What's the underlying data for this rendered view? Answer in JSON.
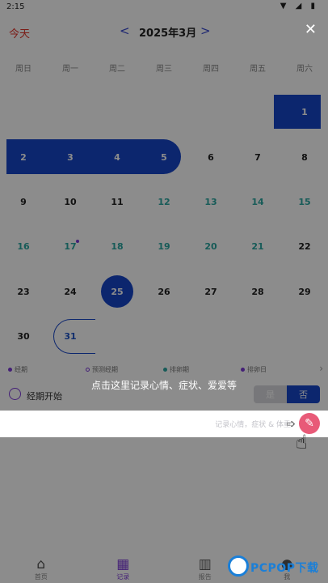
{
  "status_bar": {
    "time": "2:15",
    "icons": "▼ ◢ ▮"
  },
  "header": {
    "today": "今天",
    "month_title": "2025年3月",
    "prev": "<",
    "next": ">",
    "close": "✕"
  },
  "weekdays": [
    "周日",
    "周一",
    "周二",
    "周三",
    "周四",
    "周五",
    "周六"
  ],
  "days": [
    {
      "n": "1"
    },
    {
      "n": "2"
    },
    {
      "n": "3"
    },
    {
      "n": "4"
    },
    {
      "n": "5"
    },
    {
      "n": "6"
    },
    {
      "n": "7"
    },
    {
      "n": "8"
    },
    {
      "n": "9"
    },
    {
      "n": "10"
    },
    {
      "n": "11"
    },
    {
      "n": "12"
    },
    {
      "n": "13"
    },
    {
      "n": "14"
    },
    {
      "n": "15"
    },
    {
      "n": "16"
    },
    {
      "n": "17"
    },
    {
      "n": "18"
    },
    {
      "n": "19"
    },
    {
      "n": "20"
    },
    {
      "n": "21"
    },
    {
      "n": "22"
    },
    {
      "n": "23"
    },
    {
      "n": "24"
    },
    {
      "n": "25"
    },
    {
      "n": "26"
    },
    {
      "n": "27"
    },
    {
      "n": "28"
    },
    {
      "n": "29"
    },
    {
      "n": "30"
    },
    {
      "n": "31"
    }
  ],
  "legend": [
    {
      "label": "经期",
      "color": "#7c3ad8"
    },
    {
      "label": "预测经期",
      "color": "#7c3ad8"
    },
    {
      "label": "排卵期",
      "color": "#2aa6a0"
    },
    {
      "label": "排卵日",
      "color": "#7c3ad8"
    }
  ],
  "period_row": {
    "label": "经期开始",
    "yes": "是",
    "no": "否"
  },
  "spotlight": {
    "hint": "记录心情，症状 & 体重",
    "coach_text": "点击这里记录心情、症状、爱爱等"
  },
  "nav": [
    {
      "label": "首页",
      "icon": "home-icon"
    },
    {
      "label": "记录",
      "icon": "calendar-icon"
    },
    {
      "label": "报告",
      "icon": "bar-chart-icon"
    },
    {
      "label": "我",
      "icon": "profile-icon"
    }
  ],
  "watermark": {
    "text": "PCPOP下载"
  },
  "colors": {
    "accent": "#1745c9",
    "purple": "#7c3ad8",
    "teal": "#2aa6a0",
    "red": "#e0352b",
    "pink": "#e85a78"
  }
}
